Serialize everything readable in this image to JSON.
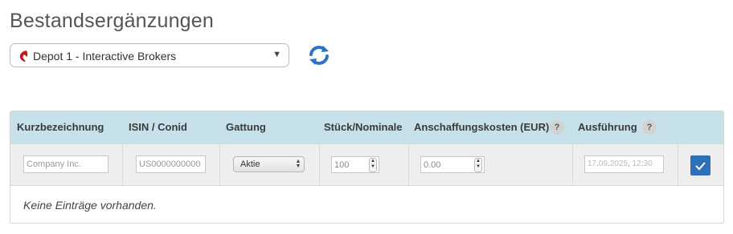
{
  "page": {
    "title": "Bestandsergänzungen"
  },
  "depot": {
    "selected": "Depot 1 - Interactive Brokers",
    "caret": "▼"
  },
  "table": {
    "columns": {
      "kurz": "Kurzbezeichnung",
      "isin": "ISIN / Conid",
      "gattung": "Gattung",
      "stueck": "Stück/Nominale",
      "kosten": "Anschaffungskosten (EUR)",
      "ausfuehrung": "Ausführung"
    },
    "help_glyph": "?",
    "input_row": {
      "kurz_placeholder": "Company Inc.",
      "isin_placeholder": "US0000000000",
      "gattung_value": "Aktie",
      "stueck_value": "100",
      "kosten_value": "0.00",
      "date": {
        "day": "17",
        "month": "09",
        "year": "2025",
        "hour": "12",
        "minute": "30"
      }
    },
    "empty_text": "Keine Einträge vorhanden."
  },
  "colors": {
    "header_bg": "#c6e1e9",
    "accent": "#2f6fb6",
    "row_bg": "#eeeeee"
  }
}
